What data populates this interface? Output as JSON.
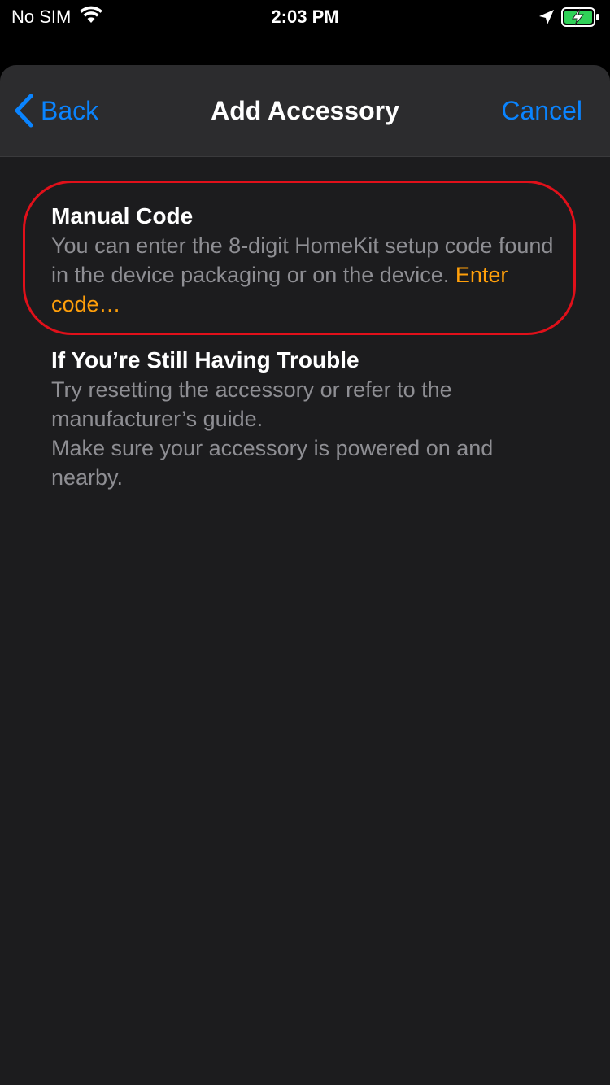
{
  "status_bar": {
    "carrier": "No SIM",
    "time": "2:03 PM",
    "icons": [
      "wifi-icon",
      "location-icon",
      "battery-charging-icon"
    ],
    "battery_color": "#30d158"
  },
  "nav": {
    "back_label": "Back",
    "title": "Add Accessory",
    "cancel_label": "Cancel"
  },
  "manual_code": {
    "title": "Manual Code",
    "body": "You can enter the 8-digit HomeKit setup code found in the device packaging or on the device.",
    "link": "Enter code…"
  },
  "trouble": {
    "title": "If You’re Still Having Trouble",
    "line1": "Try resetting the accessory or refer to the manufacturer’s guide.",
    "line2": "Make sure your accessory is powered on and nearby."
  },
  "colors": {
    "accent": "#0a84ff",
    "link": "#ff9f0a",
    "highlight": "#e0101a"
  }
}
